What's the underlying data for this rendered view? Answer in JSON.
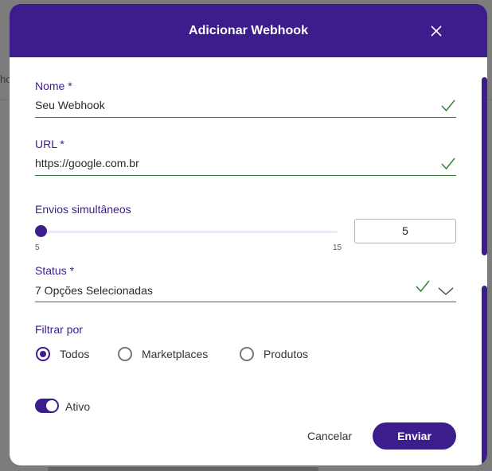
{
  "background": {
    "partial_text": "ho"
  },
  "dialog": {
    "title": "Adicionar Webhook",
    "close_icon": "close-icon",
    "colors": {
      "brand": "#3d1c8c",
      "valid": "#2e7d32"
    }
  },
  "fields": {
    "nome": {
      "label": "Nome *",
      "value": "Seu Webhook",
      "status_icon": "check-icon"
    },
    "url": {
      "label": "URL *",
      "value": "https://google.com.br",
      "status_icon": "check-icon"
    },
    "envios": {
      "label": "Envios simultâneos",
      "min": "5",
      "max": "15",
      "value": "5",
      "level": 0
    },
    "status": {
      "label": "Status *",
      "value": "7 Opções Selecionadas",
      "status_icon": "check-icon",
      "dropdown_icon": "chevron-down-icon"
    }
  },
  "filtrar": {
    "label": "Filtrar por",
    "options": [
      {
        "label": "Todos",
        "selected": true
      },
      {
        "label": "Marketplaces",
        "selected": false
      },
      {
        "label": "Produtos",
        "selected": false
      }
    ]
  },
  "ativo": {
    "label": "Ativo",
    "on": true
  },
  "buttons": {
    "cancel": "Cancelar",
    "submit": "Enviar"
  }
}
